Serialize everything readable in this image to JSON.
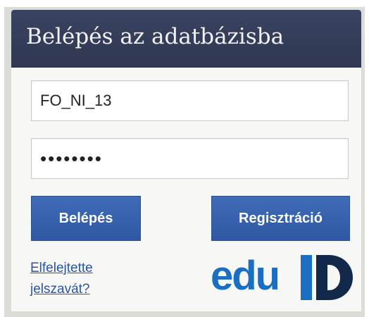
{
  "login_panel": {
    "title": "Belépés az adatbázisba",
    "username_value": "FO_NI_13",
    "password_value": "••••••••",
    "login_button_label": "Belépés",
    "register_button_label": "Regisztráció",
    "forgot_password_text": "Elfelejtette jelszavát?",
    "logo_text": "edu",
    "logo_mark": "ID"
  },
  "colors": {
    "header_bg": "#333b58",
    "button_bg": "#3561ad",
    "link": "#2a55a6",
    "logo_blue": "#1b6fc2",
    "logo_dark": "#13294b"
  }
}
